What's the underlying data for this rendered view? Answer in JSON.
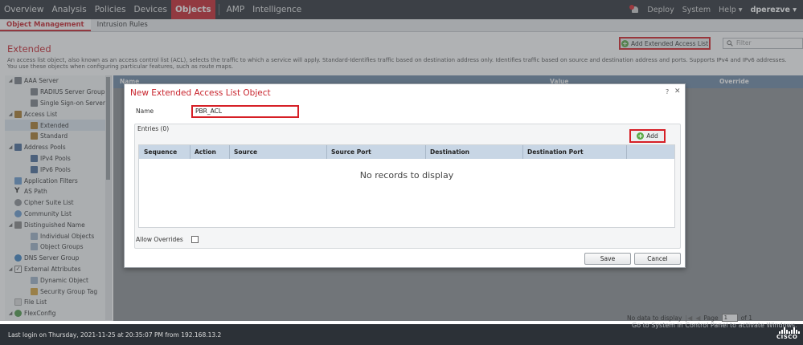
{
  "topnav": {
    "items": [
      "Overview",
      "Analysis",
      "Policies",
      "Devices",
      "Objects",
      "AMP",
      "Intelligence"
    ],
    "active": "Objects",
    "right": {
      "deploy": "Deploy",
      "system": "System",
      "help": "Help ▾",
      "user": "dperezve ▾"
    }
  },
  "subnav": {
    "items": [
      "Object Management",
      "Intrusion Rules"
    ],
    "active": "Object Management"
  },
  "page": {
    "title": "Extended",
    "add_button": "Add Extended Access List",
    "filter_placeholder": "Filter",
    "description_line1": "An access list object, also known as an access control list (ACL), selects the traffic to which a service will apply. Standard-Identifies traffic based on destination address only. Identifies traffic based on source and destination address and ports. Supports IPv4 and IPv6 addresses.",
    "description_line2": "You use these objects when configuring particular features, such as route maps."
  },
  "sidebar": {
    "items": [
      {
        "label": "AAA Server",
        "level": 0,
        "exp": "◢",
        "icon": "server"
      },
      {
        "label": "RADIUS Server Group",
        "level": 1,
        "exp": "",
        "icon": "server"
      },
      {
        "label": "Single Sign-on Server",
        "level": 1,
        "exp": "",
        "icon": "server"
      },
      {
        "label": "Access List",
        "level": 0,
        "exp": "◢",
        "icon": "list"
      },
      {
        "label": "Extended",
        "level": 1,
        "exp": "",
        "icon": "list",
        "selected": true
      },
      {
        "label": "Standard",
        "level": 1,
        "exp": "",
        "icon": "list"
      },
      {
        "label": "Address Pools",
        "level": 0,
        "exp": "◢",
        "icon": "pool"
      },
      {
        "label": "IPv4 Pools",
        "level": 1,
        "exp": "",
        "icon": "pool"
      },
      {
        "label": "IPv6 Pools",
        "level": 1,
        "exp": "",
        "icon": "pool"
      },
      {
        "label": "Application Filters",
        "level": 0,
        "exp": "",
        "icon": "filter"
      },
      {
        "label": "AS Path",
        "level": 0,
        "exp": "",
        "icon": "path"
      },
      {
        "label": "Cipher Suite List",
        "level": 0,
        "exp": "",
        "icon": "cipher"
      },
      {
        "label": "Community List",
        "level": 0,
        "exp": "",
        "icon": "comm"
      },
      {
        "label": "Distinguished Name",
        "level": 0,
        "exp": "◢",
        "icon": "dn"
      },
      {
        "label": "Individual Objects",
        "level": 1,
        "exp": "",
        "icon": "obj"
      },
      {
        "label": "Object Groups",
        "level": 1,
        "exp": "",
        "icon": "obj"
      },
      {
        "label": "DNS Server Group",
        "level": 0,
        "exp": "",
        "icon": "dns"
      },
      {
        "label": "External Attributes",
        "level": 0,
        "exp": "◢",
        "icon": "check"
      },
      {
        "label": "Dynamic Object",
        "level": 1,
        "exp": "",
        "icon": "obj"
      },
      {
        "label": "Security Group Tag",
        "level": 1,
        "exp": "",
        "icon": "tag"
      },
      {
        "label": "File List",
        "level": 0,
        "exp": "",
        "icon": "file"
      },
      {
        "label": "FlexConfig",
        "level": 0,
        "exp": "◢",
        "icon": "flex"
      }
    ]
  },
  "main_table": {
    "columns": [
      "Name",
      "Value",
      "Override"
    ]
  },
  "pager": {
    "status": "No data to display",
    "page_label": "Page",
    "page_value": "1",
    "of": "of 1"
  },
  "footer": {
    "login": "Last login on Thursday, 2021-11-25 at 20:35:07 PM from 192.168.13.2",
    "activate": "Go to System in Control Panel to activate Windows.",
    "brand": "CISCO"
  },
  "modal": {
    "title": "New Extended Access List Object",
    "help": "?",
    "close": "✕",
    "name_label": "Name",
    "name_value": "PBR_ACL",
    "entries_label": "Entries (0)",
    "add_label": "Add",
    "columns": [
      "Sequence",
      "Action",
      "Source",
      "Source Port",
      "Destination",
      "Destination Port"
    ],
    "empty_text": "No records to display",
    "overrides_label": "Allow Overrides",
    "save_label": "Save",
    "cancel_label": "Cancel"
  },
  "colors": {
    "accent": "#c8242d",
    "nav_bg": "#2c3137",
    "grid_header": "#c8d6e5",
    "add_icon": "#5aa845"
  }
}
